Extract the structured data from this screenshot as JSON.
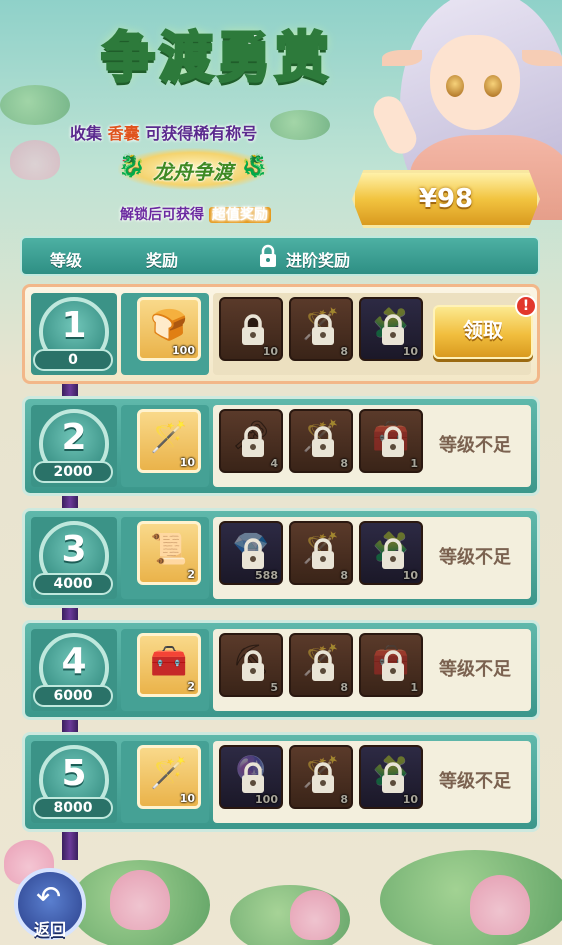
{
  "title": "争渡勇赏",
  "subtitle": {
    "prefix": "收集",
    "highlight": "香囊",
    "suffix": "可获得稀有称号"
  },
  "emblem_text": "龙舟争渡",
  "unlock_text": {
    "prefix": "解锁后可获得",
    "highlight": "超值奖励"
  },
  "price_label": "¥98",
  "header": {
    "level": "等级",
    "reward": "奖励",
    "advanced": "进阶奖励"
  },
  "rows": [
    {
      "level": "1",
      "score": "0",
      "free_qty": "100",
      "free_icon": "bread-icon",
      "locked": [
        {
          "icon": "cauldron-icon",
          "qty": "10"
        },
        {
          "icon": "staff-icon",
          "qty": "8"
        },
        {
          "icon": "puzzle-piece-icon",
          "qty": "10"
        }
      ],
      "action": "领取",
      "alert": "!"
    },
    {
      "level": "2",
      "score": "2000",
      "free_qty": "10",
      "free_icon": "staff-icon",
      "locked": [
        {
          "icon": "key-icon",
          "qty": "4"
        },
        {
          "icon": "staff-icon",
          "qty": "8"
        },
        {
          "icon": "chest-icon",
          "qty": "1"
        }
      ],
      "status": "等级不足"
    },
    {
      "level": "3",
      "score": "4000",
      "free_qty": "2",
      "free_icon": "scroll-icon",
      "locked": [
        {
          "icon": "diamond-icon",
          "qty": "588"
        },
        {
          "icon": "staff-icon",
          "qty": "8"
        },
        {
          "icon": "puzzle-piece-icon",
          "qty": "10"
        }
      ],
      "status": "等级不足"
    },
    {
      "level": "4",
      "score": "6000",
      "free_qty": "2",
      "free_icon": "chest-icon",
      "locked": [
        {
          "icon": "pickaxe-icon",
          "qty": "5"
        },
        {
          "icon": "staff-icon",
          "qty": "8"
        },
        {
          "icon": "chest-icon",
          "qty": "1"
        }
      ],
      "status": "等级不足"
    },
    {
      "level": "5",
      "score": "8000",
      "free_qty": "10",
      "free_icon": "staff-icon",
      "locked": [
        {
          "icon": "orb-icon",
          "qty": "100"
        },
        {
          "icon": "staff-icon",
          "qty": "8"
        },
        {
          "icon": "puzzle-piece-icon",
          "qty": "10"
        }
      ],
      "status": "等级不足"
    }
  ],
  "back_label": "返回",
  "colors": {
    "teal": "#3b978b",
    "gold": "#f1be3e",
    "purple": "#5a2a8e"
  }
}
